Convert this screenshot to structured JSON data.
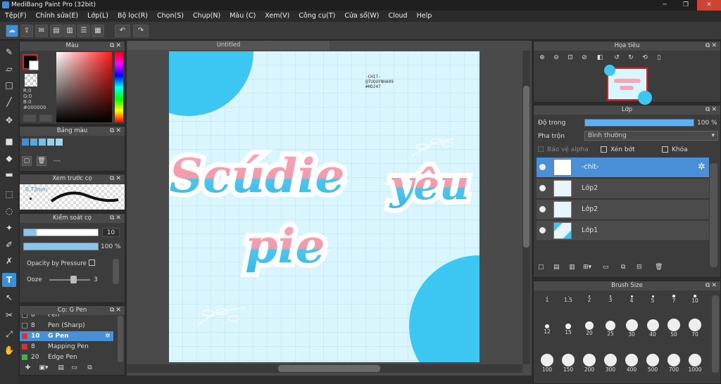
{
  "window": {
    "title": "MediBang Paint Pro (32bit)",
    "min": "─",
    "max": "❐",
    "close": "✕"
  },
  "menu": [
    "Tệp(F)",
    "Chỉnh sửa(E)",
    "Lớp(L)",
    "Bộ lọc(R)",
    "Chọn(S)",
    "Chụp(N)",
    "Màu (C)",
    "Xem(V)",
    "Công cụ(T)",
    "Cửa sổ(W)",
    "Cloud",
    "Help"
  ],
  "color_panel": {
    "title": "Màu",
    "r": "R:0",
    "g": "G:0",
    "b": "B:0",
    "hex": "#000000"
  },
  "palette_panel": {
    "title": "Bảng màu",
    "empty": "---",
    "swatches": [
      "#3d8fd6",
      "#5aa7dc",
      "#76c0e4",
      "#95d1ea",
      "#9fd8ef"
    ]
  },
  "brush_preview": {
    "title": "Xem trước cọ",
    "size": "0.73mm"
  },
  "brush_control": {
    "title": "Kiểm soát cọ",
    "size": "10",
    "opacity": "100 %",
    "opacity_pressure": "Opacity by Pressure",
    "ooze": "Ooze",
    "ooze_value": "3"
  },
  "brush_list": {
    "title": "Cọ: G Pen",
    "items": [
      {
        "size": "8",
        "name": "Pen",
        "color": "#333333"
      },
      {
        "size": "8",
        "name": "Pen (Sharp)",
        "color": "#333333"
      },
      {
        "size": "10",
        "name": "G Pen",
        "color": "#e23030"
      },
      {
        "size": "8",
        "name": "Mapping Pen",
        "color": "#e23030"
      },
      {
        "size": "20",
        "name": "Edge Pen",
        "color": "#3fb24a"
      }
    ]
  },
  "canvas": {
    "tab": "Untitled",
    "text_big_1": "Scúdie",
    "text_big_2": "yêu",
    "text_big_3": "pie",
    "watermark_1": "-CHIT-",
    "watermark_2": "@TUQUYNHA09",
    "watermark_3": "#HD247"
  },
  "navigator": {
    "title": "Họa tiêu"
  },
  "layers_panel": {
    "title": "Lớp",
    "opacity_label": "Độ trong",
    "opacity_value": "100 %",
    "opacity_fraction": 1.0,
    "blend_label": "Pha trộn",
    "blend_value": "Bình thường",
    "protect_alpha": "Bảo vệ alpha",
    "clipping": "Xén bớt",
    "lock": "Khóa",
    "layers": [
      {
        "name": "-chit-"
      },
      {
        "name": "Lớp2"
      },
      {
        "name": "Lớp2"
      },
      {
        "name": "Lớp1"
      }
    ]
  },
  "brush_size": {
    "title": "Brush Size",
    "sizes": [
      "1",
      "1.5",
      "2",
      "3",
      "4",
      "5",
      "7",
      "10",
      "12",
      "15",
      "20",
      "25",
      "30",
      "40",
      "50",
      "70",
      "100",
      "150",
      "200",
      "300",
      "400",
      "500",
      "700",
      "1000"
    ]
  }
}
